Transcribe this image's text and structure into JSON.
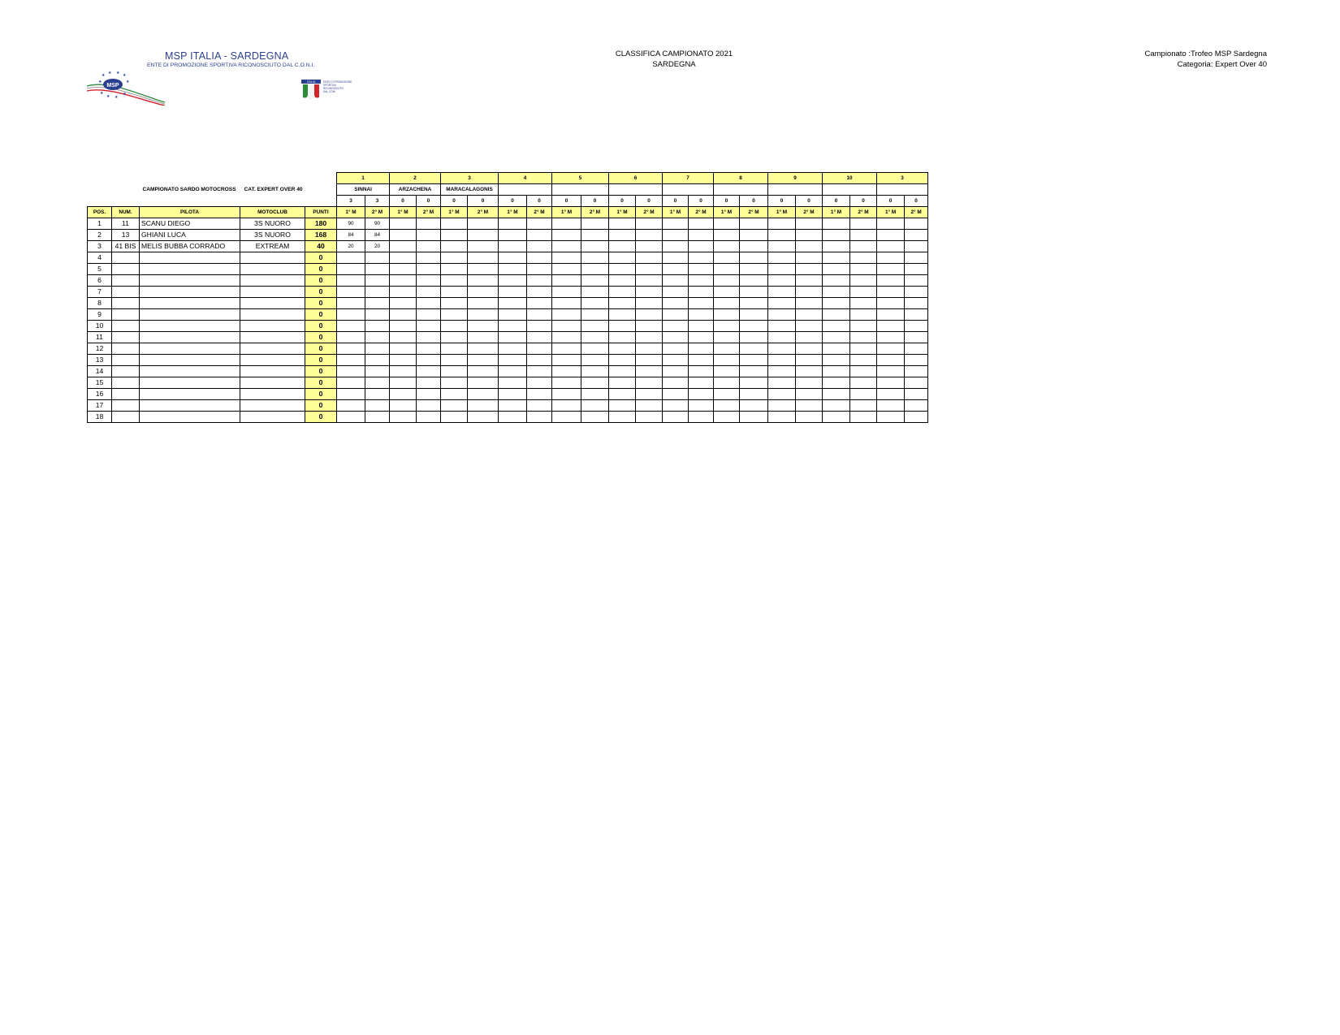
{
  "header": {
    "org_title": "MSP ITALIA - SARDEGNA",
    "org_subtitle": "ENTE DI PROMOZIONE SPORTIVA RICONOSCIUTO DAL C.O.N.I.",
    "logo_text": "MSP",
    "coni_badge_text": "ITALIA",
    "coni_caption": [
      "ENTE DI PROMOZIONE",
      "SPORTIVA",
      "RICONOSCIUTO",
      "DAL CONI"
    ],
    "center_line1": "CLASSIFICA CAMPIONATO 2021",
    "center_line2": "SARDEGNA",
    "right_line1": "Campionato :Trofeo MSP Sardegna",
    "right_line2": "Categoria: Expert Over 40"
  },
  "table": {
    "title_left": "CAMPIONATO SARDO MOTOCROSS",
    "title_right": "CAT. EXPERT OVER 40",
    "rounds": [
      "1",
      "2",
      "3",
      "4",
      "5",
      "6",
      "7",
      "8",
      "9",
      "10",
      "3"
    ],
    "venues": [
      "SINNAI",
      "ARZACHENA",
      "MARACALAGONIS",
      "",
      "",
      "",
      "",
      "",
      "",
      "",
      ""
    ],
    "race_counts": [
      "3",
      "3",
      "0",
      "0",
      "0",
      "0",
      "0",
      "0",
      "0",
      "0",
      "0",
      "0",
      "0",
      "0",
      "0",
      "0",
      "0",
      "0",
      "0",
      "0",
      "0",
      "0"
    ],
    "race_labels": [
      "1° M",
      "2° M"
    ],
    "columns": {
      "pos": "POS.",
      "num": "NUM.",
      "pilota": "PILOTA",
      "motoclub": "MOTOCLUB",
      "punti": "PUNTI"
    },
    "rows": [
      {
        "pos": "1",
        "num": "11",
        "pilota": "SCANU DIEGO",
        "motoclub": "3S NUORO",
        "punti": "180",
        "r1": "90",
        "r2": "90"
      },
      {
        "pos": "2",
        "num": "13",
        "pilota": "GHIANI LUCA",
        "motoclub": "3S NUORO",
        "punti": "168",
        "r1": "84",
        "r2": "84"
      },
      {
        "pos": "3",
        "num": "41 BIS",
        "pilota": "MELIS BUBBA CORRADO",
        "motoclub": "EXTREAM",
        "punti": "40",
        "r1": "20",
        "r2": "20"
      },
      {
        "pos": "4",
        "num": "",
        "pilota": "",
        "motoclub": "",
        "punti": "0",
        "r1": "",
        "r2": ""
      },
      {
        "pos": "5",
        "num": "",
        "pilota": "",
        "motoclub": "",
        "punti": "0",
        "r1": "",
        "r2": ""
      },
      {
        "pos": "6",
        "num": "",
        "pilota": "",
        "motoclub": "",
        "punti": "0",
        "r1": "",
        "r2": ""
      },
      {
        "pos": "7",
        "num": "",
        "pilota": "",
        "motoclub": "",
        "punti": "0",
        "r1": "",
        "r2": ""
      },
      {
        "pos": "8",
        "num": "",
        "pilota": "",
        "motoclub": "",
        "punti": "0",
        "r1": "",
        "r2": ""
      },
      {
        "pos": "9",
        "num": "",
        "pilota": "",
        "motoclub": "",
        "punti": "0",
        "r1": "",
        "r2": ""
      },
      {
        "pos": "10",
        "num": "",
        "pilota": "",
        "motoclub": "",
        "punti": "0",
        "r1": "",
        "r2": ""
      },
      {
        "pos": "11",
        "num": "",
        "pilota": "",
        "motoclub": "",
        "punti": "0",
        "r1": "",
        "r2": ""
      },
      {
        "pos": "12",
        "num": "",
        "pilota": "",
        "motoclub": "",
        "punti": "0",
        "r1": "",
        "r2": ""
      },
      {
        "pos": "13",
        "num": "",
        "pilota": "",
        "motoclub": "",
        "punti": "0",
        "r1": "",
        "r2": ""
      },
      {
        "pos": "14",
        "num": "",
        "pilota": "",
        "motoclub": "",
        "punti": "0",
        "r1": "",
        "r2": ""
      },
      {
        "pos": "15",
        "num": "",
        "pilota": "",
        "motoclub": "",
        "punti": "0",
        "r1": "",
        "r2": ""
      },
      {
        "pos": "16",
        "num": "",
        "pilota": "",
        "motoclub": "",
        "punti": "0",
        "r1": "",
        "r2": ""
      },
      {
        "pos": "17",
        "num": "",
        "pilota": "",
        "motoclub": "",
        "punti": "0",
        "r1": "",
        "r2": ""
      },
      {
        "pos": "18",
        "num": "",
        "pilota": "",
        "motoclub": "",
        "punti": "0",
        "r1": "",
        "r2": ""
      }
    ]
  },
  "colors": {
    "header_fill": "#ffff99",
    "logo_blue": "#2a3f8f",
    "flag_green": "#2e8b3a",
    "flag_red": "#d2232a"
  }
}
